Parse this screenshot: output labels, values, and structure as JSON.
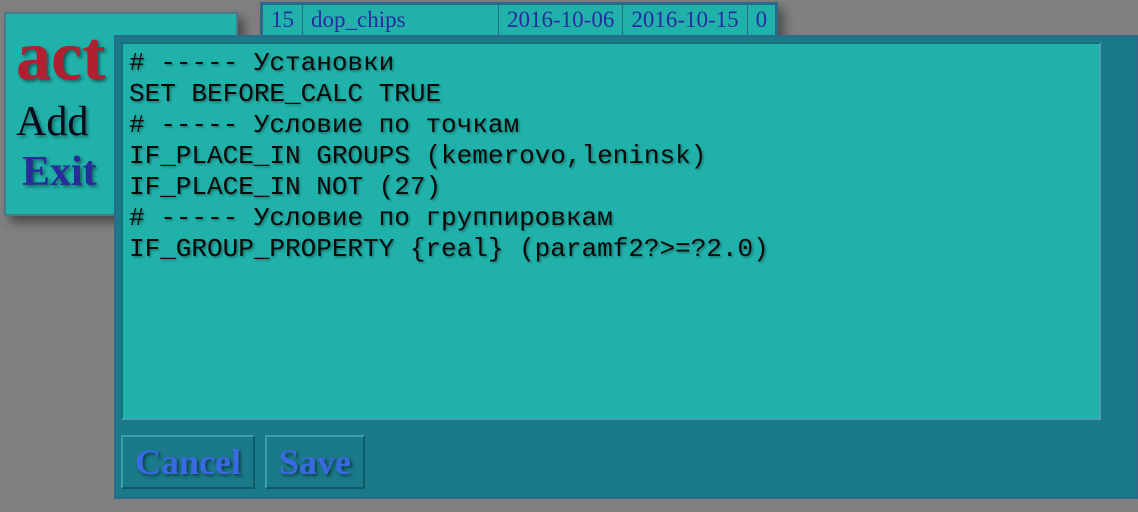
{
  "sidebar": {
    "title": "act",
    "add_label": "Add",
    "exit_label": "Exit"
  },
  "table": {
    "rows": [
      {
        "id": "15",
        "name": "dop_chips",
        "date1": "2016-10-06",
        "date2": "2016-10-15",
        "flag": "0"
      }
    ]
  },
  "editor": {
    "content": "# ----- Установки\nSET BEFORE_CALC TRUE\n# ----- Условие по точкам\nIF_PLACE_IN GROUPS (kemerovo,leninsk)\nIF_PLACE_IN NOT (27)\n# ----- Условие по группировкам\nIF_GROUP_PROPERTY {real} (paramf2?>=?2.0)"
  },
  "modal": {
    "cancel_label": "Cancel",
    "save_label": "Save"
  }
}
